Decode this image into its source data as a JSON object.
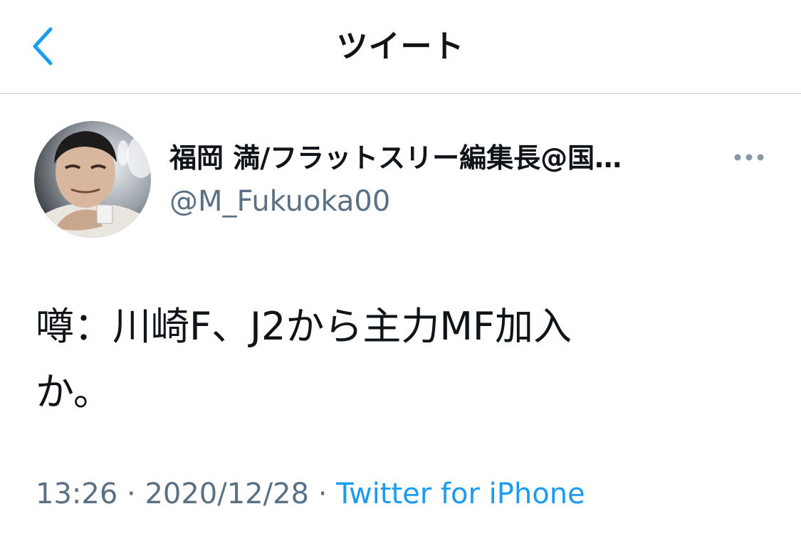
{
  "header": {
    "title": "ツイート",
    "back_icon": "chevron-left-icon",
    "accent_color": "#1d9bf0"
  },
  "tweet": {
    "author": {
      "display_name": "福岡 満/フラットスリー編集長@国…",
      "handle": "@M_Fukuoka00",
      "avatar": "profile-photo"
    },
    "more_icon": "more-horizontal-icon",
    "text": "噂：川崎F、J2から主力MF加入\nか。",
    "meta": {
      "time": "13:26",
      "separator": " · ",
      "date": "2020/12/28",
      "source": "Twitter for iPhone"
    }
  },
  "colors": {
    "text_primary": "#0f1419",
    "text_secondary": "#5b7083",
    "link": "#1d9bf0",
    "divider": "#cfd3d6"
  }
}
